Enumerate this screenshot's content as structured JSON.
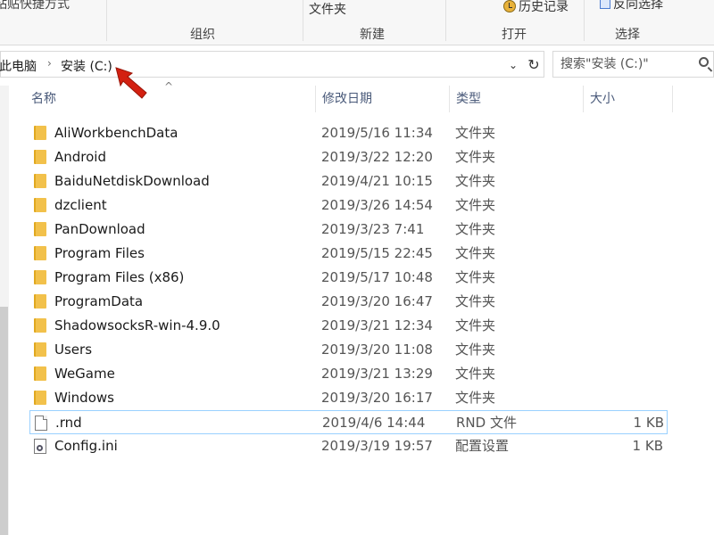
{
  "ribbon": {
    "cut_left_label": "粘贴快捷方式",
    "new_folder_label": "文件夹",
    "history_label": "历史记录",
    "select_label": "反向选择",
    "groups": [
      "组织",
      "新建",
      "打开",
      "选择"
    ]
  },
  "address": {
    "crumb_pc": "此电脑",
    "crumb_drive": "安装 (C:)",
    "search_placeholder": "搜索\"安装 (C:)\""
  },
  "columns": {
    "name": "名称",
    "date": "修改日期",
    "type": "类型",
    "size": "大小"
  },
  "rows": [
    {
      "icon": "folder-icon",
      "name": "AliWorkbenchData",
      "date": "2019/5/16 11:34",
      "type": "文件夹",
      "size": ""
    },
    {
      "icon": "folder-icon",
      "name": "Android",
      "date": "2019/3/22 12:20",
      "type": "文件夹",
      "size": ""
    },
    {
      "icon": "folder-icon",
      "name": "BaiduNetdiskDownload",
      "date": "2019/4/21 10:15",
      "type": "文件夹",
      "size": ""
    },
    {
      "icon": "folder-icon",
      "name": "dzclient",
      "date": "2019/3/26 14:54",
      "type": "文件夹",
      "size": ""
    },
    {
      "icon": "folder-icon",
      "name": "PanDownload",
      "date": "2019/3/23 7:41",
      "type": "文件夹",
      "size": ""
    },
    {
      "icon": "folder-icon",
      "name": "Program Files",
      "date": "2019/5/15 22:45",
      "type": "文件夹",
      "size": ""
    },
    {
      "icon": "folder-icon",
      "name": "Program Files (x86)",
      "date": "2019/5/17 10:48",
      "type": "文件夹",
      "size": ""
    },
    {
      "icon": "folder-icon",
      "name": "ProgramData",
      "date": "2019/3/20 16:47",
      "type": "文件夹",
      "size": ""
    },
    {
      "icon": "folder-icon",
      "name": "ShadowsocksR-win-4.9.0",
      "date": "2019/3/21 12:34",
      "type": "文件夹",
      "size": ""
    },
    {
      "icon": "folder-icon",
      "name": "Users",
      "date": "2019/3/20 11:08",
      "type": "文件夹",
      "size": ""
    },
    {
      "icon": "folder-icon",
      "name": "WeGame",
      "date": "2019/3/21 13:29",
      "type": "文件夹",
      "size": ""
    },
    {
      "icon": "folder-icon",
      "name": "Windows",
      "date": "2019/3/20 16:17",
      "type": "文件夹",
      "size": ""
    },
    {
      "icon": "file-icon",
      "name": ".rnd",
      "date": "2019/4/6 14:44",
      "type": "RND 文件",
      "size": "1 KB",
      "selected": true
    },
    {
      "icon": "config-icon",
      "name": "Config.ini",
      "date": "2019/3/19 19:57",
      "type": "配置设置",
      "size": "1 KB"
    }
  ],
  "colors": {
    "accent": "#99d1ff",
    "arrow": "#d32011",
    "folder": "#f2c14b"
  }
}
